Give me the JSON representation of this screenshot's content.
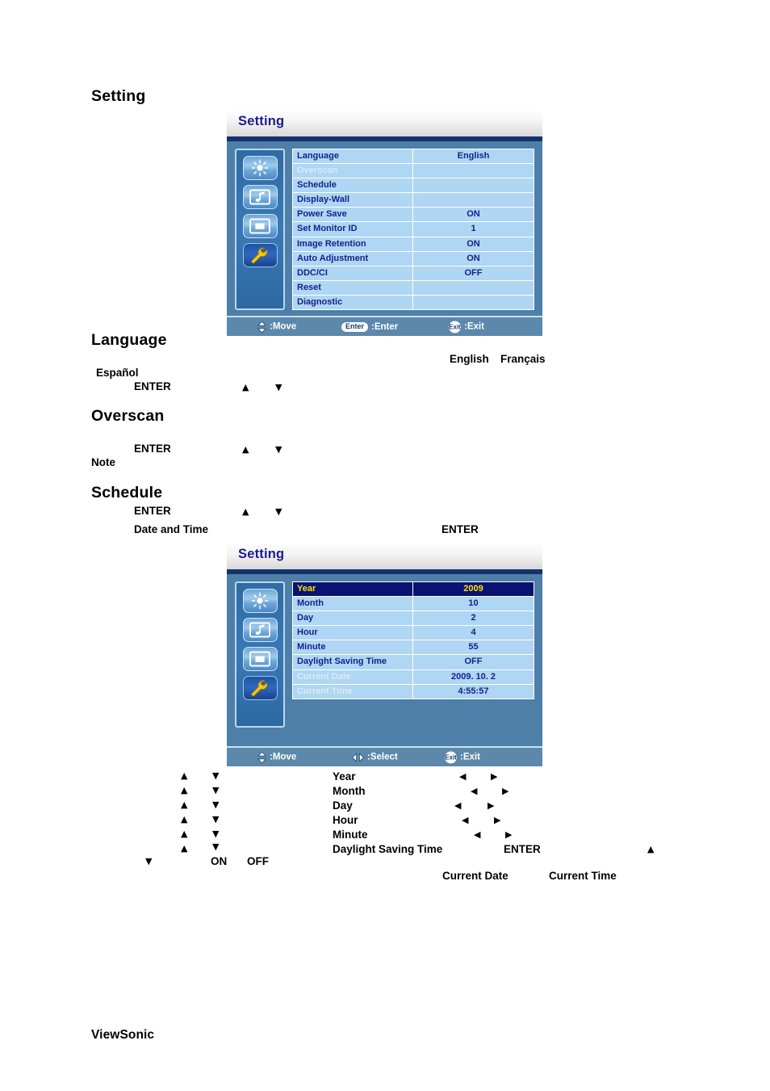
{
  "page": {
    "heading": "Setting",
    "footer_brand": "ViewSonic"
  },
  "sections": {
    "language": {
      "heading": "Language",
      "terms": [
        "English",
        "Français",
        "Español",
        "ENTER"
      ]
    },
    "overscan": {
      "heading": "Overscan",
      "terms": [
        "ENTER",
        "Note"
      ]
    },
    "schedule": {
      "heading": "Schedule",
      "terms": [
        "ENTER",
        "Date and Time",
        "ENTER"
      ]
    }
  },
  "osd_setting": {
    "title": "Setting",
    "icons": [
      {
        "name": "brightness-icon",
        "selected": false
      },
      {
        "name": "audio-icon",
        "selected": false
      },
      {
        "name": "screen-icon",
        "selected": false
      },
      {
        "name": "tools-wrench-icon",
        "selected": true
      }
    ],
    "rows": [
      {
        "label": "Language",
        "value": "English",
        "state": "normal"
      },
      {
        "label": "Overscan",
        "value": "",
        "state": "dim"
      },
      {
        "label": "Schedule",
        "value": "",
        "state": "normal"
      },
      {
        "label": "Display-Wall",
        "value": "",
        "state": "normal"
      },
      {
        "label": "Power Save",
        "value": "ON",
        "state": "normal"
      },
      {
        "label": "Set Monitor ID",
        "value": "1",
        "state": "normal"
      },
      {
        "label": "Image Retention",
        "value": "ON",
        "state": "normal"
      },
      {
        "label": "Auto Adjustment",
        "value": "ON",
        "state": "normal"
      },
      {
        "label": "DDC/CI",
        "value": "OFF",
        "state": "normal"
      },
      {
        "label": "Reset",
        "value": "",
        "state": "normal"
      },
      {
        "label": "Diagnostic",
        "value": "",
        "state": "normal"
      }
    ],
    "footer": {
      "move_label": ":Move",
      "mid_key": "Enter",
      "mid_label": ":Enter",
      "exit_key": "Exit",
      "exit_label": ":Exit"
    }
  },
  "osd_datetime": {
    "title": "Setting",
    "icons": [
      {
        "name": "brightness-icon",
        "selected": false
      },
      {
        "name": "audio-icon",
        "selected": false
      },
      {
        "name": "screen-icon",
        "selected": false
      },
      {
        "name": "tools-wrench-icon",
        "selected": true
      }
    ],
    "rows": [
      {
        "label": "Year",
        "value": "2009",
        "state": "highlight"
      },
      {
        "label": "Month",
        "value": "10",
        "state": "normal"
      },
      {
        "label": "Day",
        "value": "2",
        "state": "normal"
      },
      {
        "label": "Hour",
        "value": "4",
        "state": "normal"
      },
      {
        "label": "Minute",
        "value": "55",
        "state": "normal"
      },
      {
        "label": "Daylight Saving Time",
        "value": "OFF",
        "state": "normal"
      },
      {
        "label": "Current Date",
        "value": "2009. 10. 2",
        "state": "dim"
      },
      {
        "label": "Current Time",
        "value": "4:55:57",
        "state": "dim"
      }
    ],
    "footer": {
      "move_label": ":Move",
      "mid_label": ":Select",
      "exit_key": "Exit",
      "exit_label": ":Exit"
    }
  },
  "datetime_notes": {
    "labels": [
      "Year",
      "Month",
      "Day",
      "Hour",
      "Minute",
      "Daylight Saving Time"
    ],
    "enter": "ENTER",
    "on": "ON",
    "off": "OFF",
    "current_date": "Current Date",
    "current_time": "Current Time"
  },
  "colors": {
    "osd_panel_bg": "#4d7fa8",
    "osd_row_bg": "#afd6f2",
    "osd_text": "#14228c",
    "osd_highlight_bg": "#0a1272",
    "osd_highlight_text": "#ffe400",
    "osd_title": "#1b1b8f",
    "osd_rule": "#13316b"
  }
}
